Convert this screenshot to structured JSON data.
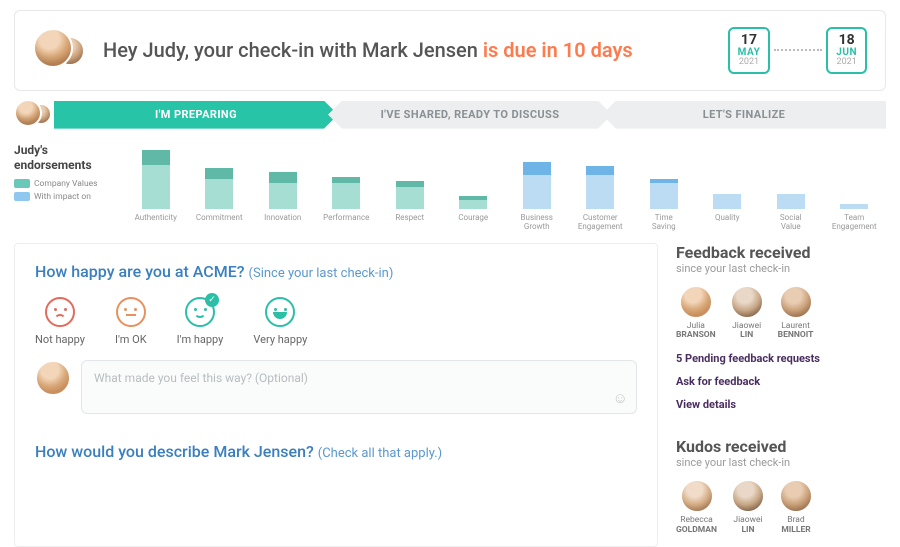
{
  "header": {
    "greeting_prefix": "Hey Judy, your check-in with Mark Jensen ",
    "greeting_due": "is due in 10 days",
    "start_date": {
      "day": "17",
      "month": "MAY",
      "year": "2021"
    },
    "end_date": {
      "day": "18",
      "month": "JUN",
      "year": "2021"
    }
  },
  "stepper": {
    "step1": "I'M PREPARING",
    "step2": "I'VE SHARED, READY TO DISCUSS",
    "step3": "LET'S FINALIZE"
  },
  "legend": {
    "title": "Judy's endorsements",
    "item1": "Company Values",
    "item2": "With impact on",
    "color1": "#69c8b7",
    "color2": "#8fc7ef"
  },
  "chart_data": {
    "type": "bar",
    "title": "Judy's endorsements",
    "ylim": [
      0,
      60
    ],
    "categories": [
      "Authenticity",
      "Commitment",
      "Innovation",
      "Performance",
      "Respect",
      "Courage",
      "Business Growth",
      "Customer Engagement",
      "Time Saving",
      "Quality",
      "Social Value",
      "Team Engagement"
    ],
    "series": [
      {
        "name": "Company Values",
        "color": "#69c8b7",
        "values": [
          55,
          38,
          34,
          30,
          26,
          12,
          0,
          0,
          0,
          0,
          0,
          0
        ]
      },
      {
        "name": "With impact on",
        "color": "#8fc7ef",
        "values": [
          0,
          0,
          0,
          0,
          0,
          0,
          44,
          40,
          28,
          14,
          14,
          4
        ]
      }
    ],
    "dark_caps": [
      14,
      10,
      10,
      6,
      6,
      4,
      12,
      8,
      4,
      0,
      0,
      0
    ]
  },
  "happiness": {
    "question": "How happy are you at ACME?",
    "hint": "(Since your last check-in)",
    "options": {
      "o0": "Not happy",
      "o1": "I'm OK",
      "o2": "I'm happy",
      "o3": "Very happy"
    },
    "selected_index": 2,
    "comment_placeholder": "What made you feel this way? (Optional)"
  },
  "describe": {
    "question": "How would you describe Mark Jensen?",
    "hint": "(Check all that apply.)"
  },
  "feedback": {
    "title": "Feedback received",
    "sub": "since your last check-in",
    "people": {
      "p0": {
        "first": "Julia",
        "last": "BRANSON"
      },
      "p1": {
        "first": "Jiaowei",
        "last": "LIN"
      },
      "p2": {
        "first": "Laurent",
        "last": "BENNOIT"
      }
    },
    "link_pending": "5 Pending feedback requests",
    "link_ask": "Ask for feedback",
    "link_view": "View details"
  },
  "kudos": {
    "title": "Kudos received",
    "sub": "since your last check-in",
    "people": {
      "p0": {
        "first": "Rebecca",
        "last": "GOLDMAN"
      },
      "p1": {
        "first": "Jiaowei",
        "last": "LIN"
      },
      "p2": {
        "first": "Brad",
        "last": "MILLER"
      }
    }
  }
}
